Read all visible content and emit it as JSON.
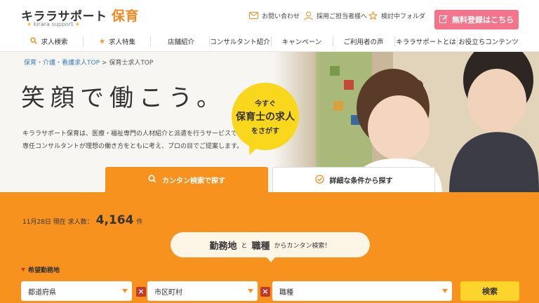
{
  "header": {
    "logo_main": "キララサポート",
    "logo_accent": "保育",
    "logo_sub": "kirara support",
    "util_contact": "お問い合わせ",
    "util_recruit": "採用ご担当者様へ",
    "util_folder": "検討中フォルダ",
    "register_button": "無料登録はこちら"
  },
  "nav": {
    "items": [
      {
        "label": "求人検索",
        "icon": "search-icon"
      },
      {
        "label": "求人特集",
        "icon": "star-icon"
      },
      {
        "label": "店舗紹介"
      },
      {
        "label": "コンサルタント紹介"
      },
      {
        "label": "キャンペーン"
      },
      {
        "label": "ご利用者の声"
      },
      {
        "label": "キララサポートとは"
      },
      {
        "label": "お役立ちコンテンツ"
      }
    ]
  },
  "hero": {
    "breadcrumb_link": "保育・介護・看護求人TOP",
    "breadcrumb_sep": ">",
    "breadcrumb_current": "保育士求人TOP",
    "title": "笑顔で働こう。",
    "desc_line1": "キララサポート保育は、医療・福祉専門の人材紹介と派遣を行うサービスです。",
    "desc_line2": "専任コンサルタントが理想の働き方をともに考え、プロの目でご提案します。",
    "bubble_line1": "今すぐ",
    "bubble_line2": "保育士の求人",
    "bubble_line3": "をさがす"
  },
  "tabs": {
    "easy": "カンタン検索で探す",
    "detail": "詳細な条件から探す"
  },
  "search": {
    "date": "11月28日 現在 求人数：",
    "count": "4,164",
    "count_unit": "件",
    "pill_word1": "勤務地",
    "pill_and": "と",
    "pill_word2": "職種",
    "pill_rest": "からカンタン検索！",
    "area_label": "希望勤務地",
    "prefecture_placeholder": "都道府県",
    "city_placeholder": "市区町村",
    "job_placeholder": "職種",
    "search_button": "検索"
  },
  "colors": {
    "accent": "#f7921e",
    "register": "#f4758b",
    "bubble": "#f9d71c",
    "search_button": "#fdd42a"
  }
}
